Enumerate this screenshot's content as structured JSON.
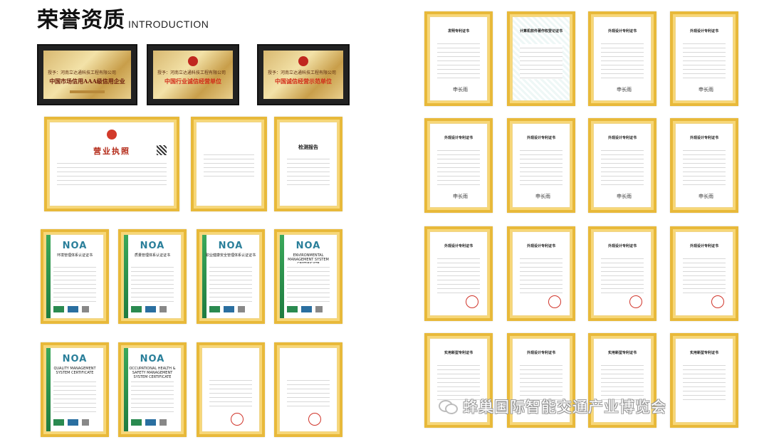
{
  "header": {
    "title_cn": "荣誉资质",
    "title_en": "INTRODUCTION"
  },
  "plaques": [
    {
      "line1": "授予：河南立达通科技工程有限公司",
      "line2": "中国市场信用AAA级信用企业"
    },
    {
      "line1": "授予：河南立达通科技工程有限公司",
      "line2": "中国行业诚信经营单位"
    },
    {
      "line1": "授予：河南立达通科技工程有限公司",
      "line2": "中国诚信经营示范单位"
    }
  ],
  "documents": {
    "business_license": "营业执照",
    "test_report": "检测报告"
  },
  "noa": {
    "logo": "NOA",
    "titles": [
      "环境管理体系认证证书",
      "质量管理体系认证证书",
      "职业健康安全管理体系认证证书",
      "ENVIRONMENTAL MANAGEMENT SYSTEM CERTIFICATE",
      "QUALITY MANAGEMENT SYSTEM CERTIFICATE",
      "OCCUPATIONAL HEALTH & SAFETY MANAGEMENT SYSTEM CERTIFICATE"
    ]
  },
  "patents": {
    "invention": "发明专利证书",
    "software": "计算机软件著作权登记证书",
    "design": "外观设计专利证书",
    "utility": "实用新型专利证书"
  },
  "watermark": {
    "icon": "wechat-icon",
    "text": "蜂巢国际智能交通产业博览会"
  },
  "colors": {
    "frame_gold": "#e8b93a",
    "noa_blue": "#2a7f9a",
    "seal_red": "#d0342a"
  }
}
